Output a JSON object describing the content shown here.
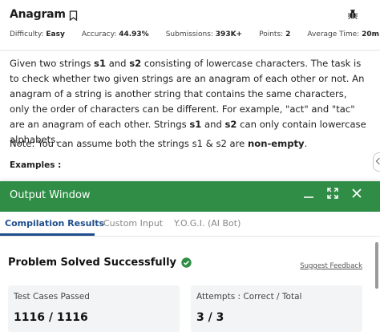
{
  "problem": {
    "title": "Anagram",
    "meta": [
      {
        "label": "Difficulty:",
        "value": "Easy"
      },
      {
        "label": "Accuracy:",
        "value": "44.93%"
      },
      {
        "label": "Submissions:",
        "value": "393K+"
      },
      {
        "label": "Points:",
        "value": "2"
      },
      {
        "label": "Average Time:",
        "value": "20m"
      }
    ],
    "description": "Given two strings s1 and s2 consisting of lowercase characters. The task is to check whether two given strings are an anagram of each other or not. An anagram of a string is another string that contains the same characters, only the order of characters can be different. For example, \"act\" and \"tac\" are an anagram of each other. Strings s1 and s2 can only contain lowercase alphabets.",
    "note": "Note: You can assume both the strings s1 & s2 are non-empty.",
    "examples_label": "Examples :"
  },
  "output_window": {
    "title": "Output Window",
    "tabs": [
      "Compilation Results",
      "Custom Input",
      "Y.O.G.I. (AI Bot)"
    ],
    "active_tab": 0,
    "status": "Problem Solved Successfully",
    "feedback": "Suggest Feedback",
    "test_cases_label": "Test Cases Passed",
    "test_cases_value": "1116 / 1116",
    "attempts_label": "Attempts : Correct / Total",
    "attempts_value": "3 / 3"
  },
  "colors": {
    "header_green": "#2f8d46",
    "active_tab": "#1e4e8c"
  }
}
